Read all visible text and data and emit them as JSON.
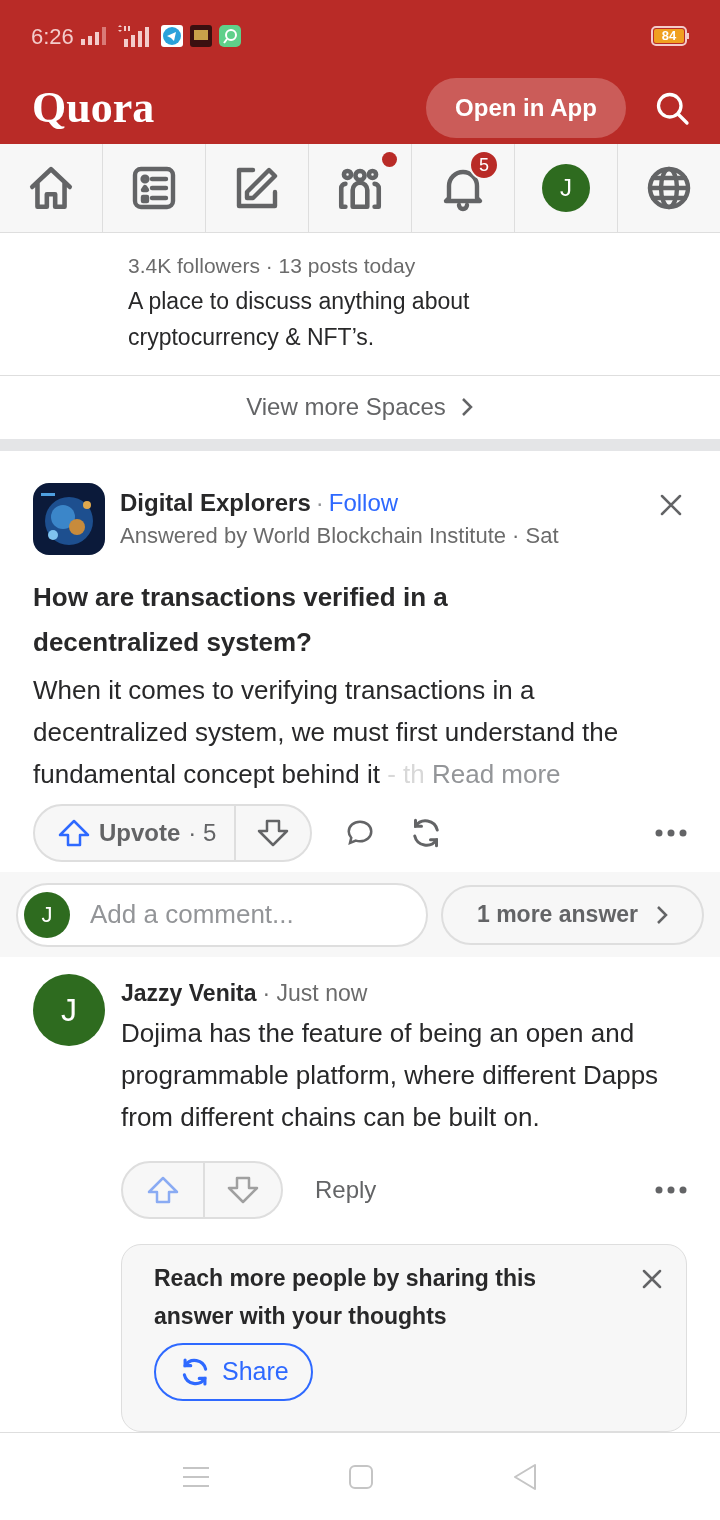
{
  "status_bar": {
    "time": "6:26",
    "battery": "84"
  },
  "header": {
    "logo": "Quora",
    "open_app": "Open in App"
  },
  "nav": [
    {
      "kind": "home",
      "selected": false
    },
    {
      "kind": "list",
      "selected": false
    },
    {
      "kind": "write",
      "selected": false
    },
    {
      "kind": "spaces",
      "selected": false,
      "dot": true
    },
    {
      "kind": "bell",
      "selected": false,
      "badge": "5"
    },
    {
      "kind": "avatar",
      "selected": false,
      "initial": "J"
    },
    {
      "kind": "globe",
      "selected": false
    }
  ],
  "space": {
    "stats": "3.4K followers · 13 posts today",
    "description": "A place to discuss anything about cryptocurrency & NFT’s.",
    "view_more": "View more Spaces"
  },
  "post": {
    "space": "Digital Explorers",
    "separator": "·",
    "follow": "Follow",
    "byline": "Answered by World Blockchain Institute · Sat",
    "question": "How are transactions verified in a decentralized system?",
    "body": "When it comes to verifying transactions in a decentralized system, we must first understand the fundamental concept behind it",
    "fade": "- th",
    "read_more": "Read more",
    "upvote": "Upvote",
    "upvotes": "· 5"
  },
  "comment_bar": {
    "initial": "J",
    "placeholder": "Add a comment...",
    "more": "1 more answer"
  },
  "comment": {
    "initial": "J",
    "author": "Jazzy Venita",
    "time": "· Just now",
    "text": "Dojima has the feature of being an open and programmable platform, where different Dapps from different chains can be built on.",
    "reply": "Reply"
  },
  "share_card": {
    "text": "Reach more people by sharing this answer with your thoughts",
    "button": "Share"
  }
}
